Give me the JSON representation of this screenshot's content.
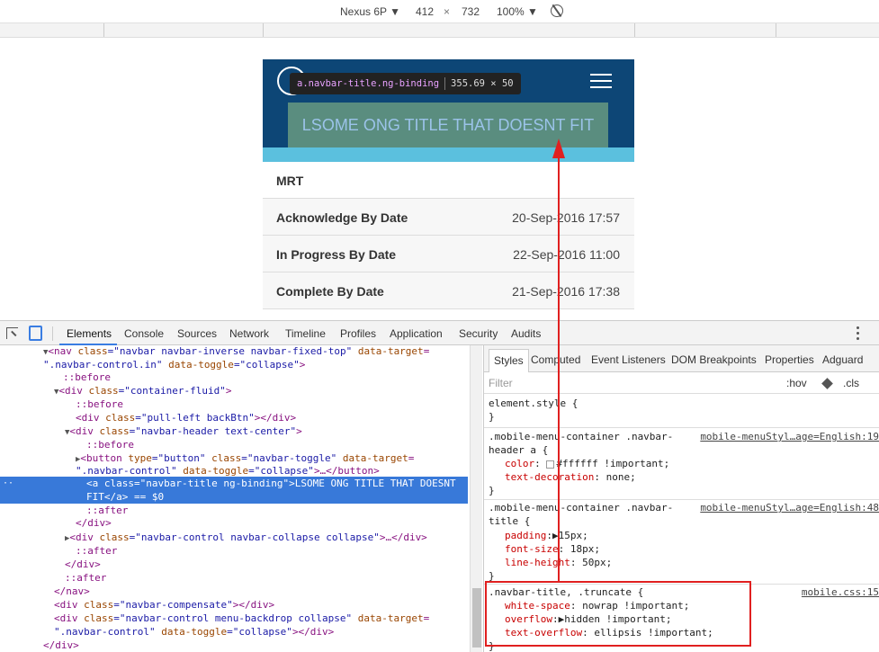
{
  "device_toolbar": {
    "device": "Nexus 6P ▼",
    "width": "412",
    "times": "×",
    "height": "732",
    "zoom": "100% ▼"
  },
  "app": {
    "tooltip_tag": "a.navbar-title.ng-binding",
    "tooltip_size": "355.69 × 50",
    "back_icon": "‹",
    "title": "LSOME ONG TITLE THAT DOESNT FIT",
    "rows": [
      {
        "label": "MRT",
        "value": ""
      },
      {
        "label": "Acknowledge By Date",
        "value": "20-Sep-2016 17:57"
      },
      {
        "label": "In Progress By Date",
        "value": "22-Sep-2016 11:00"
      },
      {
        "label": "Complete By Date",
        "value": "21-Sep-2016 17:38"
      }
    ]
  },
  "devtools": {
    "tabs": [
      "Elements",
      "Console",
      "Sources",
      "Network",
      "Timeline",
      "Profiles",
      "Application",
      "Security",
      "Audits"
    ],
    "styles_tabs": [
      "Styles",
      "Computed",
      "Event Listeners",
      "DOM Breakpoints",
      "Properties",
      "Adguard"
    ],
    "filter_placeholder": "Filter",
    "hov": ":hov",
    "cls": ".cls"
  },
  "dom_lines": {
    "l0_a": "<nav ",
    "l0_b": "class",
    "l0_c": "=\"navbar navbar-inverse navbar-fixed-top\" ",
    "l0_d": "data-target",
    "l0_e": "=",
    "l1_a": "\".navbar-control.in\" ",
    "l1_b": "data-toggle",
    "l1_c": "=\"collapse\"",
    "l1_d": ">",
    "l2": "::before",
    "l3_a": "<div ",
    "l3_b": "class",
    "l3_c": "=\"container-fluid\"",
    "l3_d": ">",
    "l4": "::before",
    "l5_a": "<div ",
    "l5_b": "class",
    "l5_c": "=\"pull-left backBtn\"",
    "l5_d": "></div>",
    "l6_a": "<div ",
    "l6_b": "class",
    "l6_c": "=\"navbar-header text-center\"",
    "l6_d": ">",
    "l7": "::before",
    "l8_a": "<button ",
    "l8_b": "type",
    "l8_c": "=\"button\" ",
    "l8_d": "class",
    "l8_e": "=\"navbar-toggle\" ",
    "l8_f": "data-target",
    "l8_g": "=",
    "l9_a": "\".navbar-control\" ",
    "l9_b": "data-toggle",
    "l9_c": "=\"collapse\"",
    "l9_d": ">…</button>",
    "l10": "<a class=\"navbar-title ng-binding\">LSOME ONG TITLE THAT DOESNT",
    "l11": "FIT</a> == $0",
    "l12": "::after",
    "l13": "</div>",
    "l14_a": "<div ",
    "l14_b": "class",
    "l14_c": "=\"navbar-control navbar-collapse collapse\"",
    "l14_d": ">…</div>",
    "l15": "::after",
    "l16": "</div>",
    "l17": "::after",
    "l18": "</nav>",
    "l19_a": "<div ",
    "l19_b": "class",
    "l19_c": "=\"navbar-compensate\"",
    "l19_d": "></div>",
    "l20_a": "<div ",
    "l20_b": "class",
    "l20_c": "=\"navbar-control menu-backdrop collapse\" ",
    "l20_d": "data-target",
    "l20_e": "=",
    "l21_a": "\".navbar-control\" ",
    "l21_b": "data-toggle",
    "l21_c": "=\"collapse\"",
    "l21_d": "></div>",
    "l22": "</div>"
  },
  "css_rules": {
    "r0_sel": "element.style {",
    "r0_close": "}",
    "r1_sel1": ".mobile-menu-container .navbar-",
    "r1_sel2": "header a {",
    "r1_src": "mobile-menuStyl…age=English:19",
    "r1_p1": "color",
    "r1_v1": "#ffffff !important;",
    "r1_p2": "text-decoration",
    "r1_v2": "none;",
    "r1_close": "}",
    "r2_sel1": ".mobile-menu-container .navbar-",
    "r2_sel2": "title {",
    "r2_src": "mobile-menuStyl…age=English:48",
    "r2_p1": "padding",
    "r2_v1": "15px;",
    "r2_p2": "font-size",
    "r2_v2": "18px;",
    "r2_p3": "line-height",
    "r2_v3": "50px;",
    "r2_close": "}",
    "r3_sel": ".navbar-title, .truncate {",
    "r3_src": "mobile.css:15",
    "r3_p1": "white-space",
    "r3_v1": "nowrap !important;",
    "r3_p2": "overflow",
    "r3_v2": "hidden !important;",
    "r3_p3": "text-overflow",
    "r3_v3": "ellipsis !important;",
    "r3_close": "}"
  }
}
